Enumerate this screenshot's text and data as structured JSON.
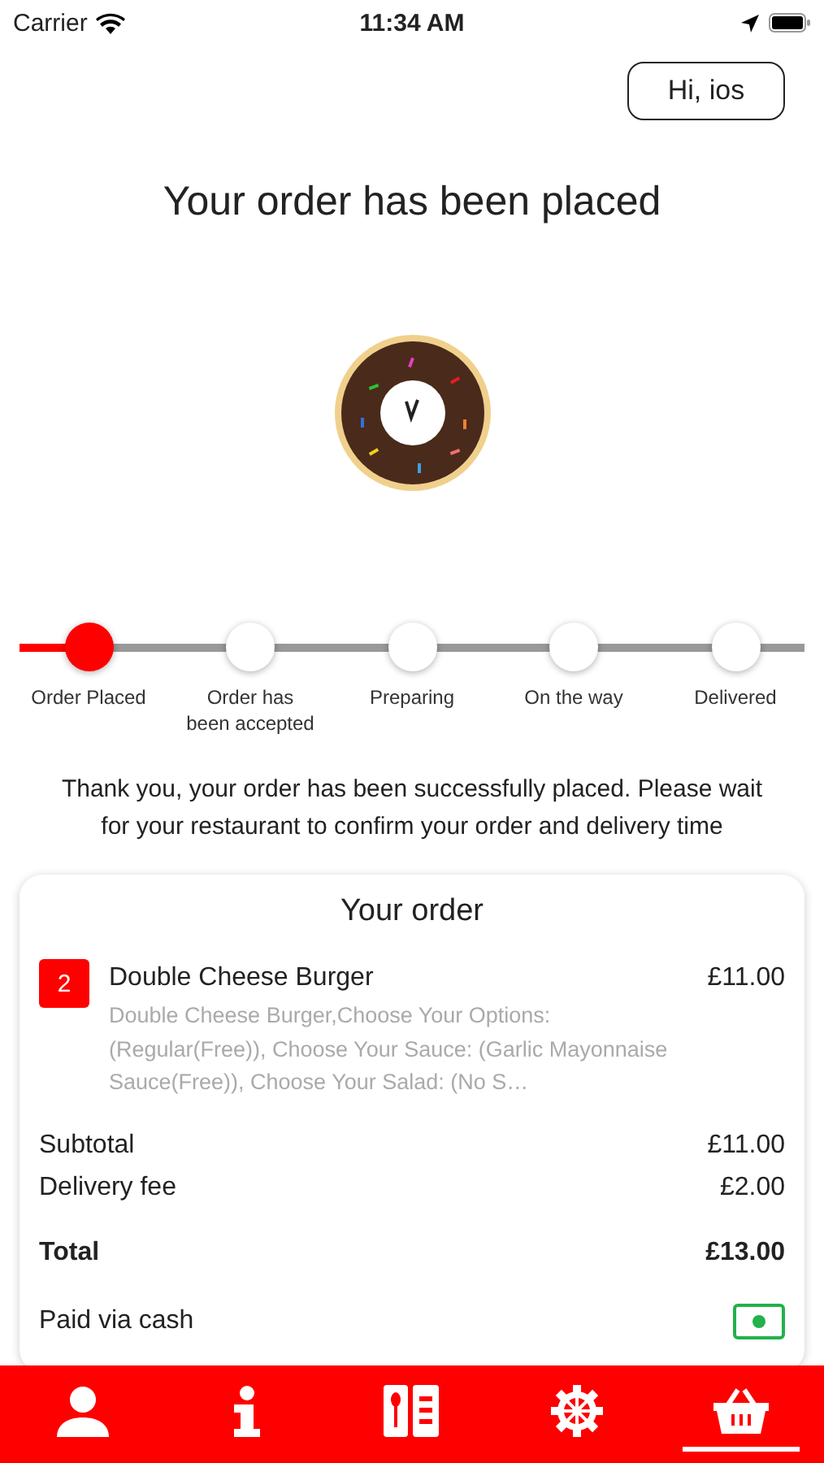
{
  "status_bar": {
    "carrier": "Carrier",
    "time": "11:34 AM"
  },
  "greeting_button": "Hi, ios",
  "title": "Your order has been placed",
  "progress": {
    "steps": [
      {
        "label": "Order Placed",
        "done": true
      },
      {
        "label": "Order has been accepted",
        "done": false
      },
      {
        "label": "Preparing",
        "done": false
      },
      {
        "label": "On the way",
        "done": false
      },
      {
        "label": "Delivered",
        "done": false
      }
    ]
  },
  "message": "Thank you, your order has been successfully placed. Please wait for your restaurant to confirm your order and delivery time",
  "order": {
    "heading": "Your order",
    "items": [
      {
        "quantity": "2",
        "name": "Double Cheese Burger",
        "price": "£11.00",
        "details": "Double Cheese Burger,Choose Your Options: (Regular(Free)), Choose Your Sauce: (Garlic Mayonnaise Sauce(Free)), Choose Your Salad: (No S…"
      }
    ],
    "subtotal": {
      "label": "Subtotal",
      "value": "£11.00"
    },
    "delivery_fee": {
      "label": "Delivery fee",
      "value": "£2.00"
    },
    "total": {
      "label": "Total",
      "value": "£13.00"
    },
    "payment": "Paid via cash"
  },
  "tab_bar": [
    {
      "kind": "profile",
      "selected": false
    },
    {
      "kind": "info",
      "selected": false
    },
    {
      "kind": "menu",
      "selected": false
    },
    {
      "kind": "settings",
      "selected": false
    },
    {
      "kind": "basket",
      "selected": true
    }
  ]
}
